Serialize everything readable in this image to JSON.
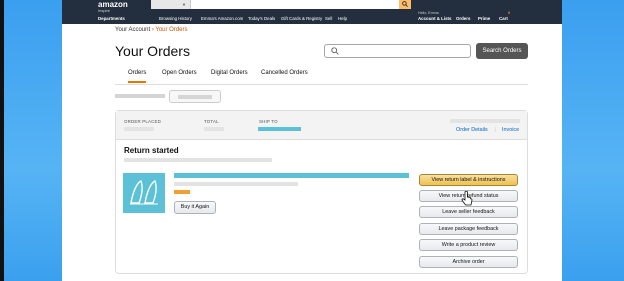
{
  "header": {
    "logo": "amazon",
    "logo_sub": "Inspire",
    "departments": "Departments",
    "nav_links": [
      "Browsing History",
      "Emma's Amazon.com",
      "Today's Deals",
      "Gift Cards & Registry",
      "Sell",
      "Help"
    ],
    "greeting": "Hello, Emma",
    "account": "Account & Lists",
    "orders": "Orders",
    "prime": "Prime",
    "cart": "Cart",
    "cart_count": "0"
  },
  "breadcrumb": {
    "parent": "Your Account",
    "separator": "›",
    "current": "Your Orders"
  },
  "page_title": "Your Orders",
  "search": {
    "placeholder": "",
    "button": "Search Orders"
  },
  "tabs": [
    "Orders",
    "Open Orders",
    "Digital Orders",
    "Cancelled Orders"
  ],
  "order": {
    "labels": {
      "placed": "ORDER PLACED",
      "total": "TOTAL",
      "ship_to": "SHIP TO"
    },
    "links": {
      "details": "Order Details",
      "invoice": "Invoice",
      "sep": "|"
    },
    "status": "Return started",
    "buy_again": "Buy it Again",
    "actions": [
      "View return label & instructions",
      "View return/refund status",
      "Leave seller feedback",
      "Leave package feedback",
      "Write a product review",
      "Archive order"
    ]
  },
  "colors": {
    "header_bg": "#232f3e",
    "accent": "#e77600",
    "link": "#0066c0",
    "teal": "#5cc1d6"
  }
}
